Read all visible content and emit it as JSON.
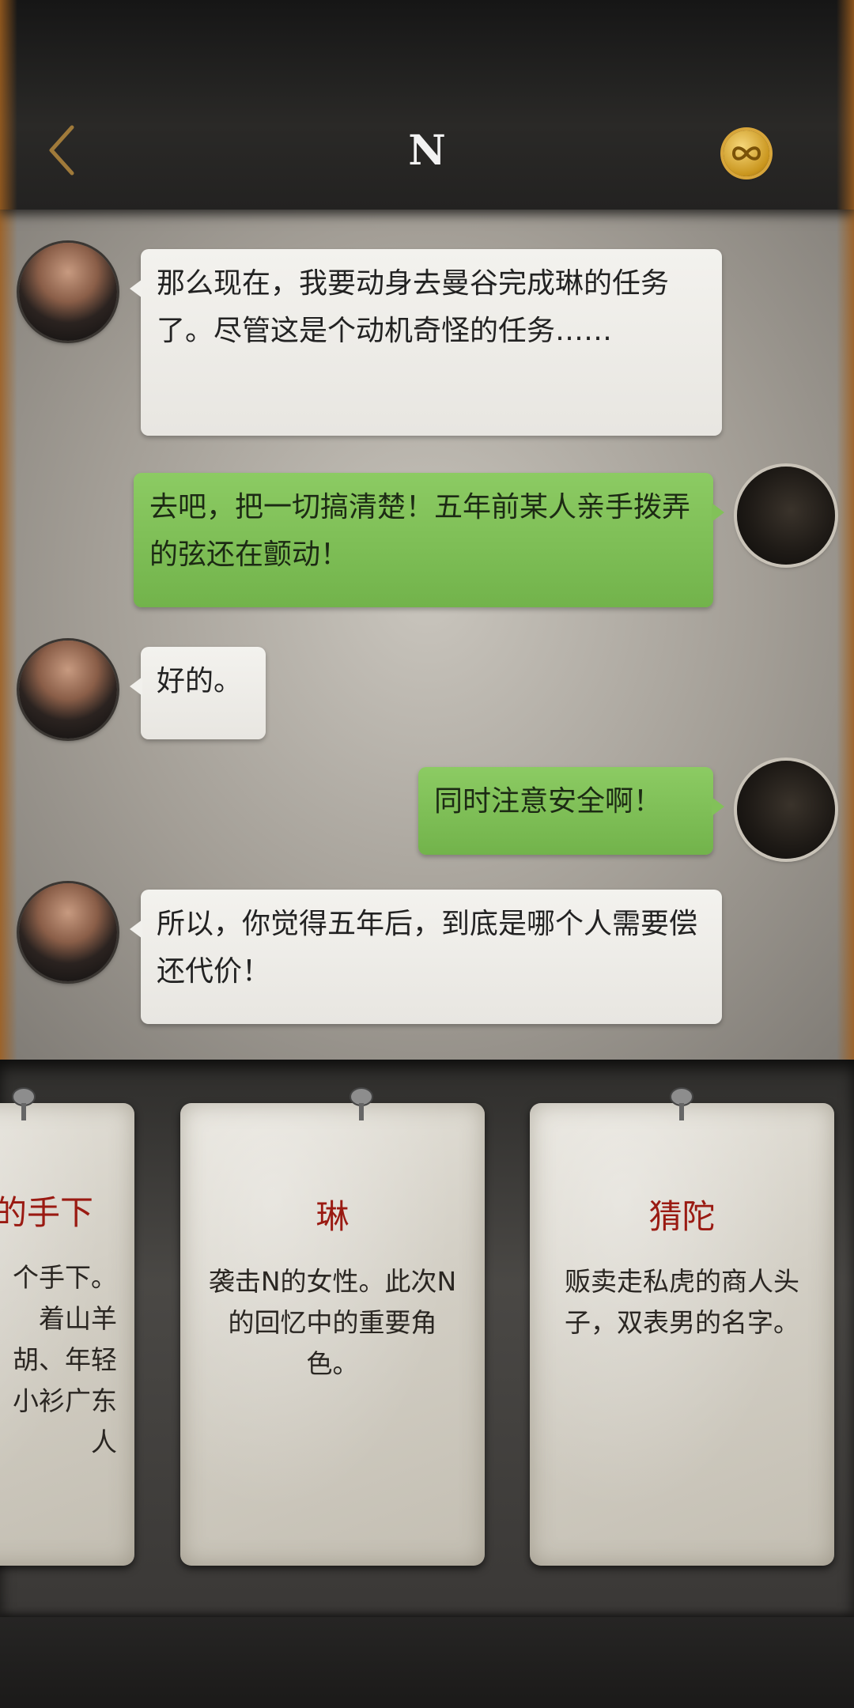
{
  "header": {
    "title": "N",
    "back_icon": "chevron-left-icon",
    "coin_icon": "infinity-coin-icon",
    "accent_color": "#d7a53a"
  },
  "messages": [
    {
      "side": "left",
      "sender": "N",
      "text": "那么现在，我要动身去曼谷完成琳的任务了。尽管这是个动机奇怪的任务……"
    },
    {
      "side": "right",
      "sender": "me",
      "text": "去吧，把一切搞清楚！五年前某人亲手拨弄的弦还在颤动！"
    },
    {
      "side": "left",
      "sender": "N",
      "text": "好的。"
    },
    {
      "side": "right",
      "sender": "me",
      "text": "同时注意安全啊！"
    },
    {
      "side": "left",
      "sender": "N",
      "text": "所以，你觉得五年后，到底是哪个人需要偿还代价！"
    }
  ],
  "cards": [
    {
      "title": "的手下",
      "desc": "个手下。着山羊胡、年轻小衫广东人"
    },
    {
      "title": "琳",
      "desc": "袭击N的女性。此次N的回忆中的重要角色。"
    },
    {
      "title": "猜陀",
      "desc": "贩卖走私虎的商人头子，双表男的名字。"
    }
  ]
}
